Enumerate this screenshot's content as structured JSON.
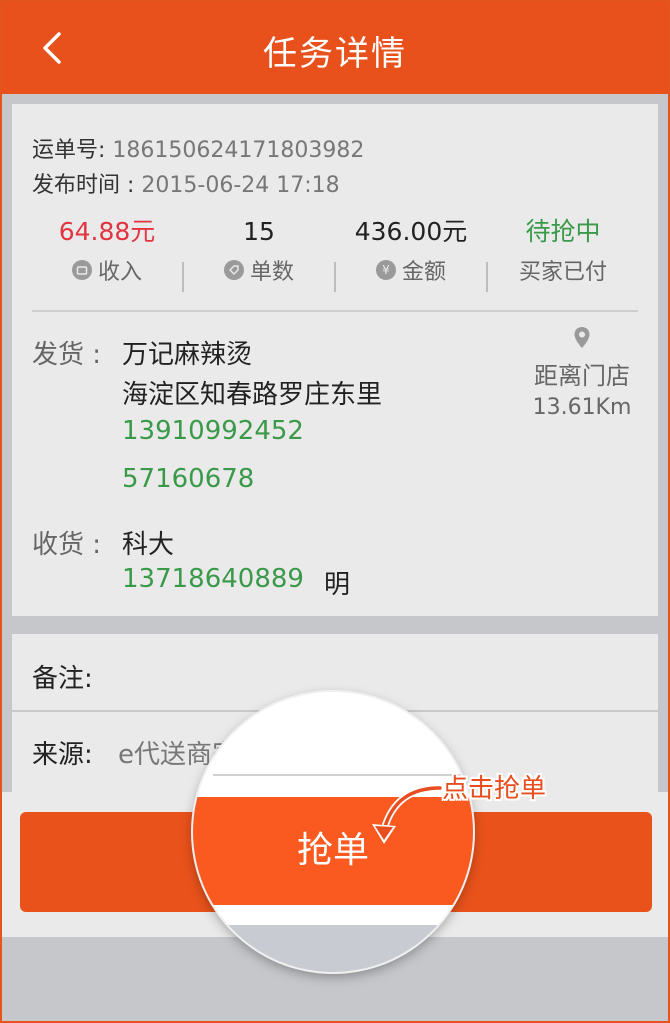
{
  "header": {
    "title": "任务详情",
    "back_icon": "chevron-left-icon"
  },
  "order": {
    "number_label": "运单号:",
    "number_value": "186150624171803982",
    "time_label": "发布时间 :",
    "time_value": "2015-06-24 17:18"
  },
  "stats": {
    "income": {
      "value": "64.88元",
      "label": "收入",
      "icon": "wallet-icon"
    },
    "count": {
      "value": "15",
      "label": "单数",
      "icon": "tag-icon"
    },
    "amount": {
      "value": "436.00元",
      "label": "金额",
      "icon": "yen-icon",
      "icon_glyph": "¥"
    },
    "status": {
      "value": "待抢中",
      "label": "买家已付"
    }
  },
  "sender": {
    "label": "发货 :",
    "name": "万记麻辣烫",
    "address": "海淀区知春路罗庄东里",
    "phone1": "13910992452",
    "phone2": "57160678"
  },
  "distance": {
    "icon": "location-pin-icon",
    "label": "距离门店",
    "value": "13.61Km"
  },
  "receiver": {
    "label": "收货 :",
    "name": "科大",
    "phone": "13718640889",
    "contact": "明"
  },
  "note": {
    "label": "备注:",
    "value": ""
  },
  "source": {
    "label": "来源:",
    "value": "e代送商家"
  },
  "action": {
    "grab_label": "抢单",
    "magnified_label": "抢单",
    "hint": "点击抢单"
  },
  "colors": {
    "accent": "#e8511c",
    "income": "#e2353f",
    "phone": "#3a9a4a",
    "status": "#3a9a4a"
  }
}
